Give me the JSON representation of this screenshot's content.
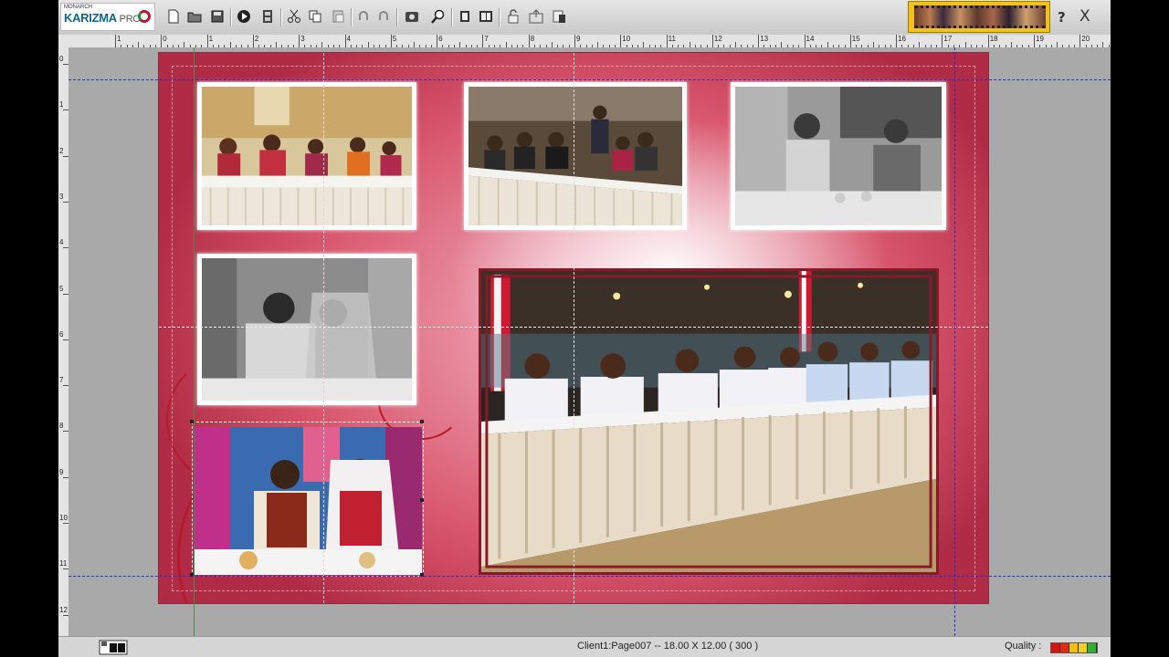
{
  "app": {
    "logo": {
      "maker": "MONARCH",
      "name": "KARIZMA",
      "edition": "PRO"
    },
    "help_label": "?",
    "close_label": "X"
  },
  "toolbar": {
    "icons": [
      "new-page-icon",
      "open-folder-icon",
      "save-icon",
      "play-icon",
      "film-icon",
      "cut-icon",
      "copy-icon",
      "paste-icon",
      "undo-icon",
      "redo-icon",
      "screenshot-icon",
      "zoom-icon",
      "fit-window-icon",
      "fit-page-icon",
      "lock-icon",
      "export-album-icon",
      "print-icon"
    ]
  },
  "ruler": {
    "labels": [
      "1",
      "0",
      "1",
      "2",
      "3",
      "4",
      "5",
      "6",
      "7",
      "8",
      "9",
      "10",
      "11",
      "12",
      "13",
      "14",
      "15",
      "16",
      "17",
      "18",
      "19",
      "20"
    ],
    "vertical_labels": [
      "0",
      "1",
      "2",
      "3",
      "4",
      "5",
      "6",
      "7",
      "8",
      "9",
      "10",
      "11",
      "12"
    ]
  },
  "status": {
    "page_info": "Client1:Page007 -- 18.00 X 12.00 ( 300 )",
    "quality_label": "Quality :",
    "quality_colors": [
      "#e01010",
      "#e02a10",
      "#f0c010",
      "#f0d020",
      "#30b030"
    ]
  },
  "album_page": {
    "photos": [
      {
        "id": "photo-family-table",
        "tone": "color"
      },
      {
        "id": "photo-hall-guests",
        "tone": "color"
      },
      {
        "id": "photo-couple-bw",
        "tone": "bw"
      },
      {
        "id": "photo-feeding-bw",
        "tone": "bw"
      },
      {
        "id": "photo-couple-color",
        "tone": "color"
      },
      {
        "id": "photo-long-table",
        "tone": "color"
      }
    ]
  }
}
